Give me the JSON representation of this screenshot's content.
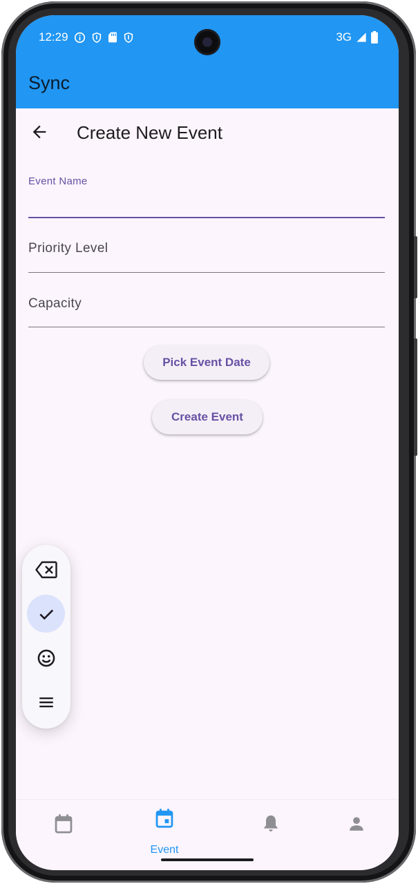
{
  "status_bar": {
    "time": "12:29",
    "left_icons": [
      "info-icon",
      "shield-icon",
      "sd-card-icon",
      "shield-icon"
    ],
    "network": "3G",
    "right_icons": [
      "signal-icon",
      "battery-icon"
    ]
  },
  "app_bar": {
    "title": "Sync",
    "color": "#2196f3"
  },
  "page": {
    "title": "Create New Event",
    "back_icon": "arrow-back-icon"
  },
  "form": {
    "event_name_label": "Event Name",
    "event_name_value": "",
    "priority_label": "Priority Level",
    "capacity_label": "Capacity",
    "pick_date_button": "Pick Event Date",
    "create_button": "Create Event"
  },
  "keyboard_toolbar": {
    "items": [
      "backspace-icon",
      "check-icon",
      "emoji-icon",
      "menu-icon"
    ],
    "selected": "check-icon"
  },
  "bottom_nav": {
    "items": [
      {
        "icon": "calendar-icon",
        "label": ""
      },
      {
        "icon": "event-icon",
        "label": "Event",
        "active": true
      },
      {
        "icon": "bell-icon",
        "label": ""
      },
      {
        "icon": "person-icon",
        "label": ""
      }
    ],
    "active_color": "#2196f3",
    "inactive_color": "#8e8e93"
  },
  "colors": {
    "accent": "#6750a4",
    "background": "#fcf5fd"
  }
}
